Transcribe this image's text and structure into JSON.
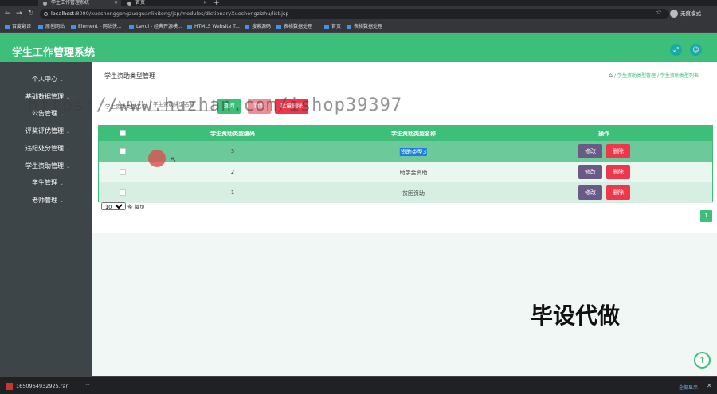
{
  "browser": {
    "tabs": [
      {
        "title": "学生工作管理系统",
        "active": true
      },
      {
        "title": "首页",
        "active": false
      }
    ],
    "url_host": "localhost",
    "url_rest": ":8080/xueshenggongzuoguanlixitong/jsp/modules/dictionaryXueshengzizhu/list.jsp",
    "profile_label": "无痕模式",
    "bookmarks": [
      "百度翻译",
      "原创网站",
      "Element - 网站快...",
      "Layui - 经典开源模...",
      "HTML5 Website T...",
      "搜索源码",
      "表格数据处理",
      "首页",
      "表格数据处理"
    ]
  },
  "app": {
    "title": "学生工作管理系统",
    "header_icons": [
      "expand-icon",
      "user-icon"
    ],
    "accent_color": "#3dbf7a"
  },
  "sidebar": {
    "items": [
      "个人中心",
      "基础数据管理",
      "公告管理",
      "评奖评优管理",
      "违纪处分管理",
      "学生资助管理",
      "学生管理",
      "老师管理"
    ]
  },
  "page": {
    "title": "学生资助类型管理",
    "breadcrumb": [
      "学生资助类型管理",
      "学生资助类型列表"
    ]
  },
  "search": {
    "label": "学生资助类型名称",
    "placeholder": "学生资助类型名称",
    "buttons": [
      "查询",
      "新增",
      "批量删除"
    ]
  },
  "watermark": "https://www.huzhan.com/ishop39397",
  "table": {
    "columns": [
      "学生资助类型编码",
      "学生资助类型名称",
      "操作"
    ],
    "rows": [
      {
        "code": "3",
        "name": "资助类型3"
      },
      {
        "code": "2",
        "name": "助学金资助"
      },
      {
        "code": "1",
        "name": "贫困资助"
      }
    ],
    "edit_label": "修改",
    "delete_label": "删除"
  },
  "pagination": {
    "page_size": "10",
    "page_size_suffix": "条 每页",
    "current_page": "1"
  },
  "overlay_text": "毕设代做",
  "downloads": {
    "file": "1650964932925.rar",
    "show_all": "全部显示"
  }
}
